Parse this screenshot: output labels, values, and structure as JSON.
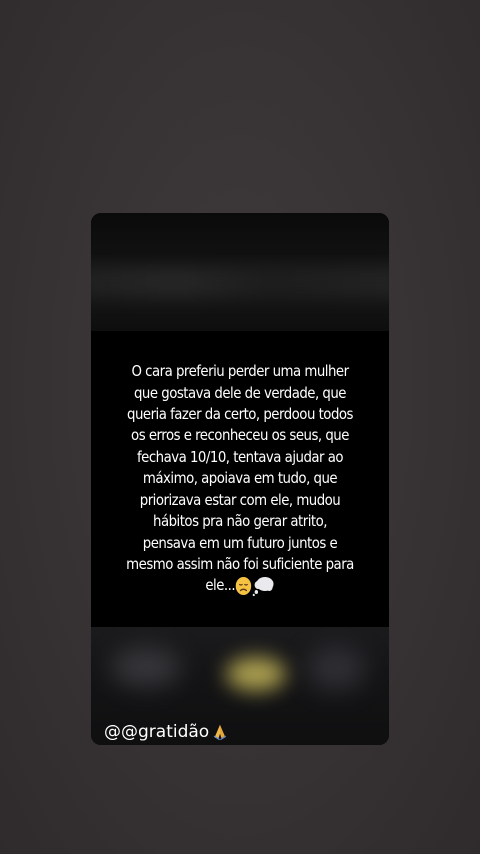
{
  "story": {
    "lines": [
      "O cara preferiu perder uma mulher",
      "que gostava dele de verdade, que",
      "queria fazer da certo, perdoou todos",
      "os erros e reconheceu os seus, que",
      "fechava 10/10, tentava ajudar ao",
      "máximo, apoiava em tudo, que",
      "priorizava estar com ele, mudou",
      "hábitos pra não gerar atrito,",
      "pensava em um futuro juntos e",
      "mesmo assim não foi suficiente para",
      "ele..."
    ],
    "emoji_icons": [
      "disappointed-face-icon",
      "thought-balloon-icon"
    ]
  },
  "mention": {
    "text": "@@gratidão",
    "icon": "folded-hands-icon"
  },
  "colors": {
    "background": "#3a3638",
    "card": "#000000",
    "text": "#ffffff",
    "glow": "#c7b85a"
  }
}
